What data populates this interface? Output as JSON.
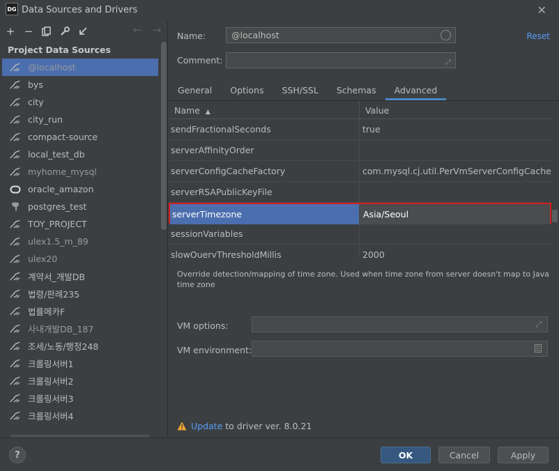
{
  "window": {
    "title": "Data Sources and Drivers",
    "logo": "DG"
  },
  "toolbar": {
    "icons": [
      "add-icon",
      "remove-icon",
      "duplicate-icon",
      "settings-wrench-icon",
      "import-icon"
    ],
    "add": "+",
    "remove": "−",
    "back": "←",
    "forward": "→"
  },
  "sidebar": {
    "section_title": "Project Data Sources",
    "items": [
      {
        "label": "@localhost",
        "icon": "mysql-icon",
        "selected": true
      },
      {
        "label": "bys",
        "icon": "mysql-icon"
      },
      {
        "label": "city",
        "icon": "mysql-icon"
      },
      {
        "label": "city_run",
        "icon": "mysql-icon"
      },
      {
        "label": "compact-source",
        "icon": "mysql-icon"
      },
      {
        "label": "local_test_db",
        "icon": "mysql-icon"
      },
      {
        "label": "myhome_mysql",
        "icon": "mysql-icon"
      },
      {
        "label": "oracle_amazon",
        "icon": "oracle-icon"
      },
      {
        "label": "postgres_test",
        "icon": "postgres-icon"
      },
      {
        "label": "TOY_PROJECT",
        "icon": "mysql-icon"
      },
      {
        "label": "ulex1.5_m_89",
        "icon": "mysql-icon"
      },
      {
        "label": "ulex20",
        "icon": "mysql-icon"
      },
      {
        "label": "계약서_개발DB",
        "icon": "mysql-icon"
      },
      {
        "label": "법령/판례235",
        "icon": "mysql-icon"
      },
      {
        "label": "법률메카F",
        "icon": "mysql-icon"
      },
      {
        "label": "사내개발DB_187",
        "icon": "mysql-icon"
      },
      {
        "label": "조세/노동/행정248",
        "icon": "mysql-icon"
      },
      {
        "label": "크롤링서버1",
        "icon": "mysql-icon"
      },
      {
        "label": "크롤링서버2",
        "icon": "mysql-icon"
      },
      {
        "label": "크롤링서버3",
        "icon": "mysql-icon"
      },
      {
        "label": "크롤링서버4",
        "icon": "mysql-icon"
      }
    ]
  },
  "form": {
    "name_label": "Name:",
    "name_value": "@localhost",
    "comment_label": "Comment:",
    "comment_value": "",
    "reset_label": "Reset"
  },
  "tabs": [
    {
      "label": "General"
    },
    {
      "label": "Options"
    },
    {
      "label": "SSH/SSL"
    },
    {
      "label": "Schemas"
    },
    {
      "label": "Advanced",
      "active": true
    }
  ],
  "properties": {
    "col_name": "Name",
    "sort_indicator": "▲",
    "col_value": "Value",
    "rows": [
      {
        "name": "sendFractionalSeconds",
        "value": "true"
      },
      {
        "name": "serverAffinityOrder",
        "value": ""
      },
      {
        "name": "serverConfigCacheFactory",
        "value": "com.mysql.cj.util.PerVmServerConfigCacheFact..."
      },
      {
        "name": "serverRSAPublicKeyFile",
        "value": ""
      },
      {
        "name": "serverTimezone",
        "value": "Asia/Seoul",
        "selected": true
      },
      {
        "name": "sessionVariables",
        "value": ""
      },
      {
        "name": "slowQueryThresholdMillis",
        "value": "2000"
      }
    ]
  },
  "description": "Override detection/mapping of time zone. Used when time zone from server doesn't map to Java time zone",
  "vm": {
    "options_label": "VM options:",
    "options_value": "",
    "environment_label": "VM environment:",
    "environment_value": ""
  },
  "update": {
    "link": "Update",
    "text": " to driver ver. 8.0.21"
  },
  "buttons": {
    "help": "?",
    "ok": "OK",
    "cancel": "Cancel",
    "apply": "Apply"
  },
  "colors": {
    "selection": "#4b6eaf",
    "highlight_border": "#d41e1e",
    "link": "#589df6",
    "ok_button": "#365880"
  }
}
